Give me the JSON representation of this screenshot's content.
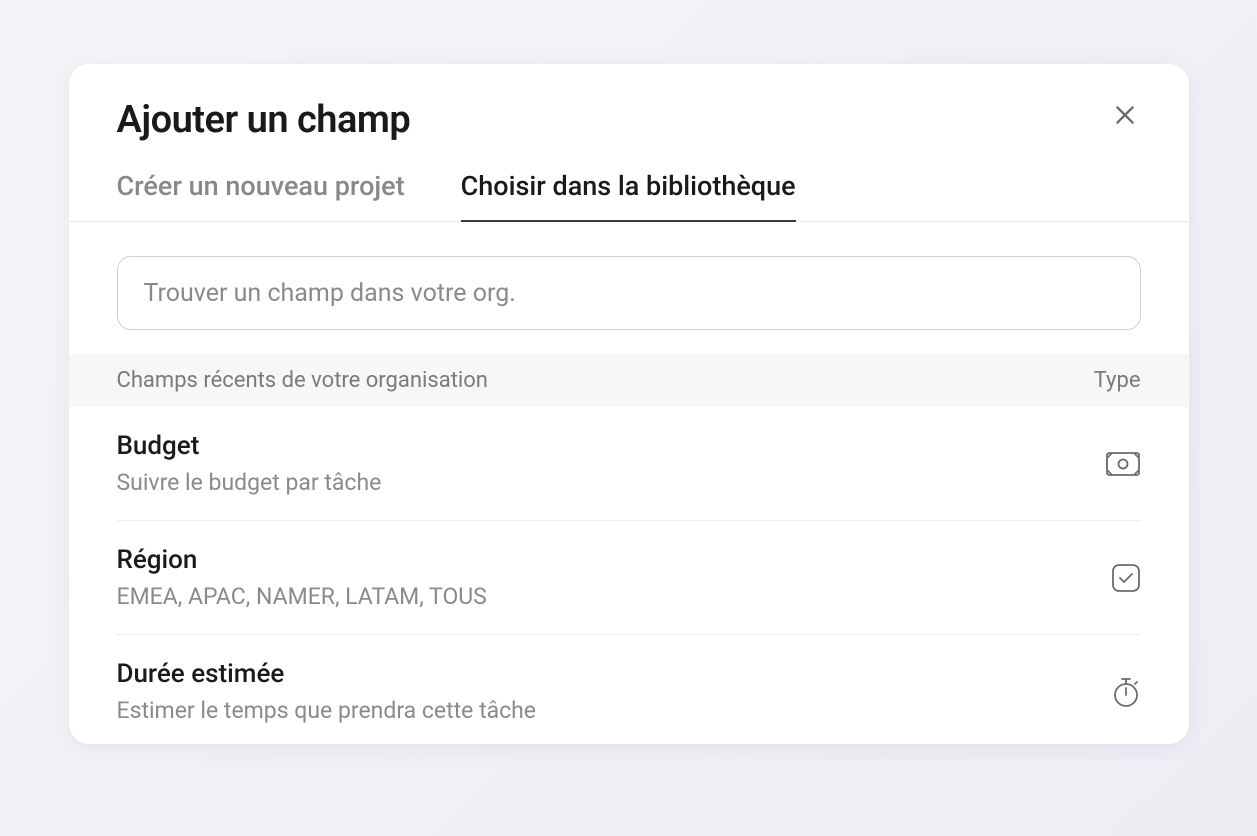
{
  "modal": {
    "title": "Ajouter un champ",
    "tabs": [
      {
        "label": "Créer un nouveau projet",
        "active": false
      },
      {
        "label": "Choisir dans la bibliothèque",
        "active": true
      }
    ],
    "search_placeholder": "Trouver un champ dans votre org.",
    "list_header_left": "Champs récents de votre organisation",
    "list_header_right": "Type",
    "items": [
      {
        "title": "Budget",
        "description": "Suivre le budget par tâche",
        "icon": "currency"
      },
      {
        "title": "Région",
        "description": "EMEA, APAC, NAMER, LATAM, TOUS",
        "icon": "checkbox"
      },
      {
        "title": "Durée estimée",
        "description": "Estimer le temps que prendra cette tâche",
        "icon": "stopwatch"
      }
    ]
  }
}
